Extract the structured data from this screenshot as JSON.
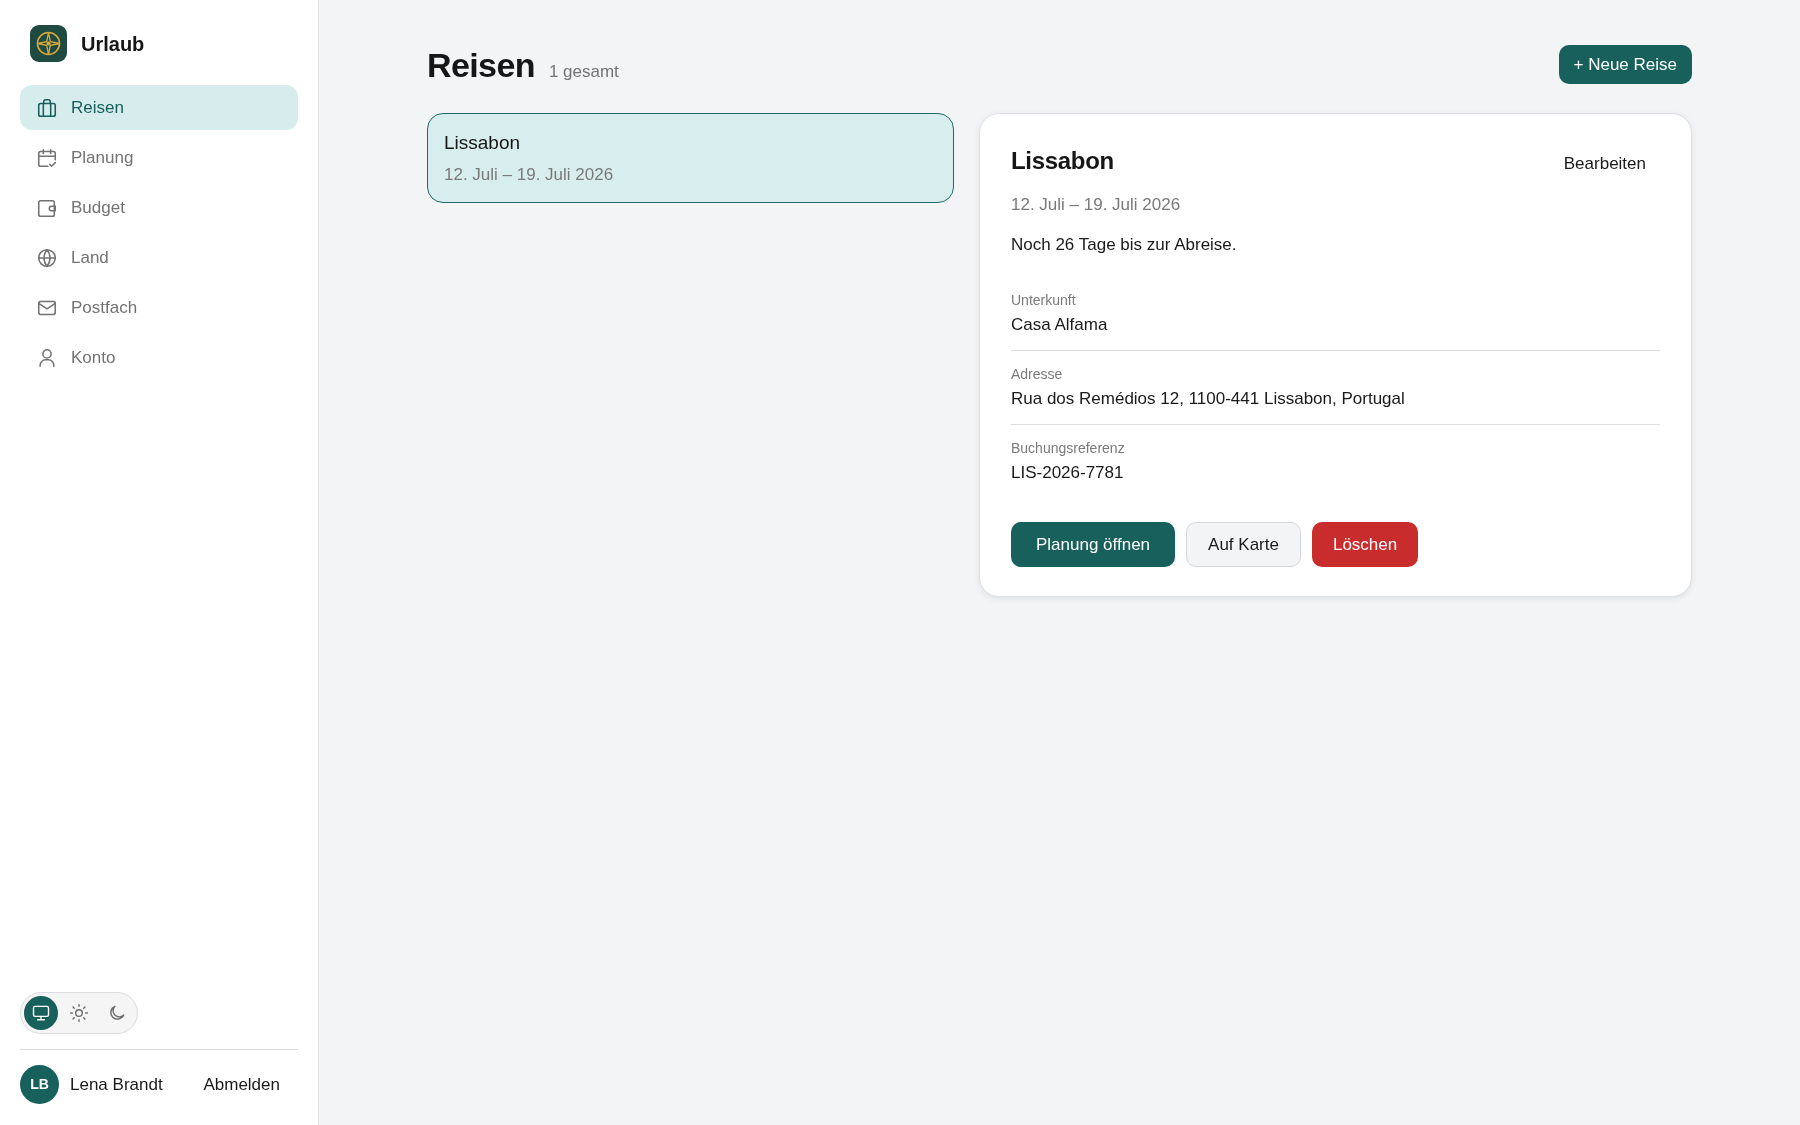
{
  "sidebar": {
    "app_title": "Urlaub",
    "nav_items": [
      {
        "label": "Reisen",
        "selected": true
      },
      {
        "label": "Planung",
        "selected": false
      },
      {
        "label": "Budget",
        "selected": false
      },
      {
        "label": "Land",
        "selected": false
      },
      {
        "label": "Postfach",
        "selected": false
      },
      {
        "label": "Konto",
        "selected": false
      }
    ],
    "theme_toggle": [
      {
        "kind": "system",
        "selected": true
      },
      {
        "kind": "light",
        "selected": false
      },
      {
        "kind": "dark",
        "selected": false
      }
    ],
    "user": {
      "initials": "LB",
      "name": "Lena Brandt",
      "logout": "Abmelden"
    }
  },
  "header": {
    "title": "Reisen",
    "count": "1 gesamt",
    "new_button": "+ Neue Reise"
  },
  "trips": [
    {
      "title": "Lissabon",
      "dates": "12. Juli – 19. Juli 2026",
      "selected": true
    }
  ],
  "detail": {
    "title": "Lissabon",
    "edit": "Bearbeiten",
    "dates": "12. Juli – 19. Juli 2026",
    "countdown": "Noch 26 Tage bis zur Abreise.",
    "fields": [
      {
        "label": "Unterkunft",
        "value": "Casa Alfama"
      },
      {
        "label": "Adresse",
        "value": "Rua dos Remédios 12, 1100-441 Lissabon, Portugal"
      },
      {
        "label": "Buchungsreferenz",
        "value": "LIS-2026-7781"
      }
    ],
    "actions": [
      {
        "label": "Planung öffnen",
        "kind": "primary"
      },
      {
        "label": "Auf Karte",
        "kind": "secondary"
      },
      {
        "label": "Löschen",
        "kind": "danger"
      }
    ]
  }
}
